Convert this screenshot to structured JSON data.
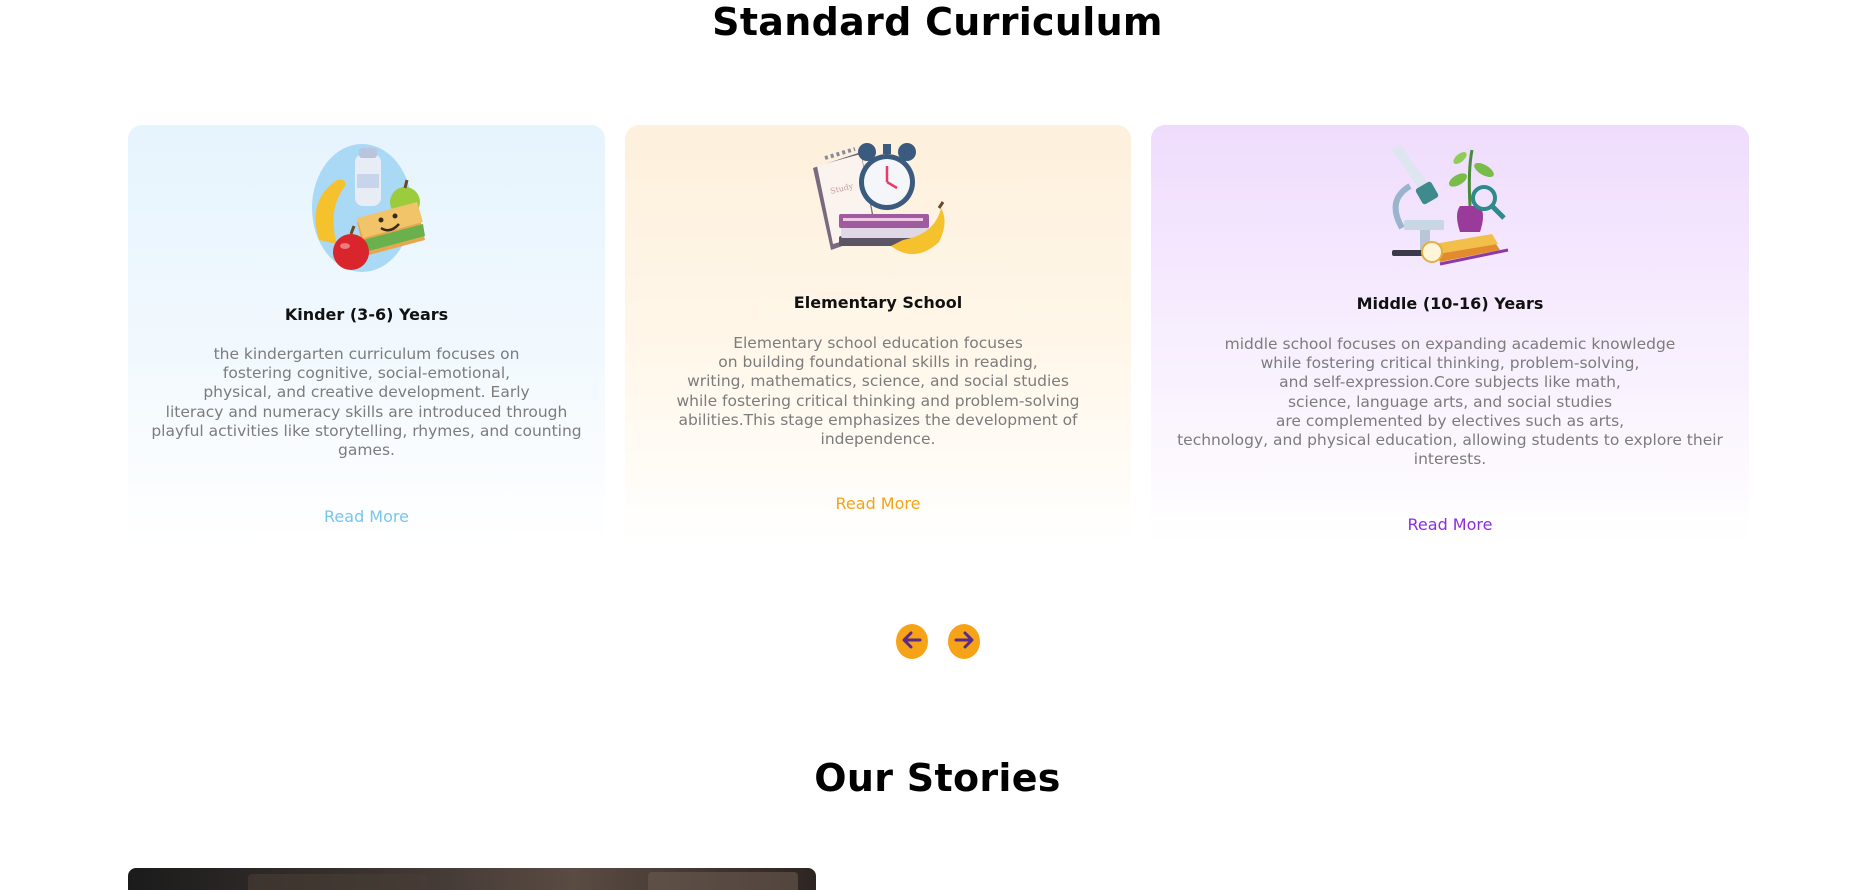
{
  "curriculum": {
    "title": "Standard Curriculum",
    "cards": [
      {
        "title": "Kinder (3-6) Years",
        "description": "the kindergarten curriculum focuses on\nfostering cognitive, social-emotional,\nphysical, and creative development. Early\nliteracy and numeracy skills are introduced through\nplayful activities like storytelling, rhymes, and counting\ngames.",
        "link": "Read More",
        "accent": "#78c6ec",
        "icon": "lunch-food-icon"
      },
      {
        "title": "Elementary School",
        "description": "Elementary school education focuses\non building foundational skills in reading,\nwriting, mathematics, science, and social studies\nwhile fostering critical thinking and problem-solving\nabilities.This stage emphasizes the development of\nindependence.",
        "link": "Read More",
        "accent": "#f2a317",
        "icon": "alarm-clock-books-icon"
      },
      {
        "title": "Middle (10-16) Years",
        "description": "middle school focuses on expanding academic knowledge\nwhile fostering critical thinking, problem-solving,\nand self-expression.Core subjects like math,\nscience, language arts, and social studies\nare complemented by electives such as arts,\ntechnology, and physical education, allowing students to explore their\ninterests.",
        "link": "Read More",
        "accent": "#8b2ee0",
        "icon": "microscope-plant-icon"
      }
    ],
    "nav": {
      "prev_icon": "arrow-left-icon",
      "next_icon": "arrow-right-icon",
      "button_color": "#f7a318",
      "arrow_color": "#5b2a86"
    }
  },
  "stories": {
    "title": "Our Stories"
  }
}
